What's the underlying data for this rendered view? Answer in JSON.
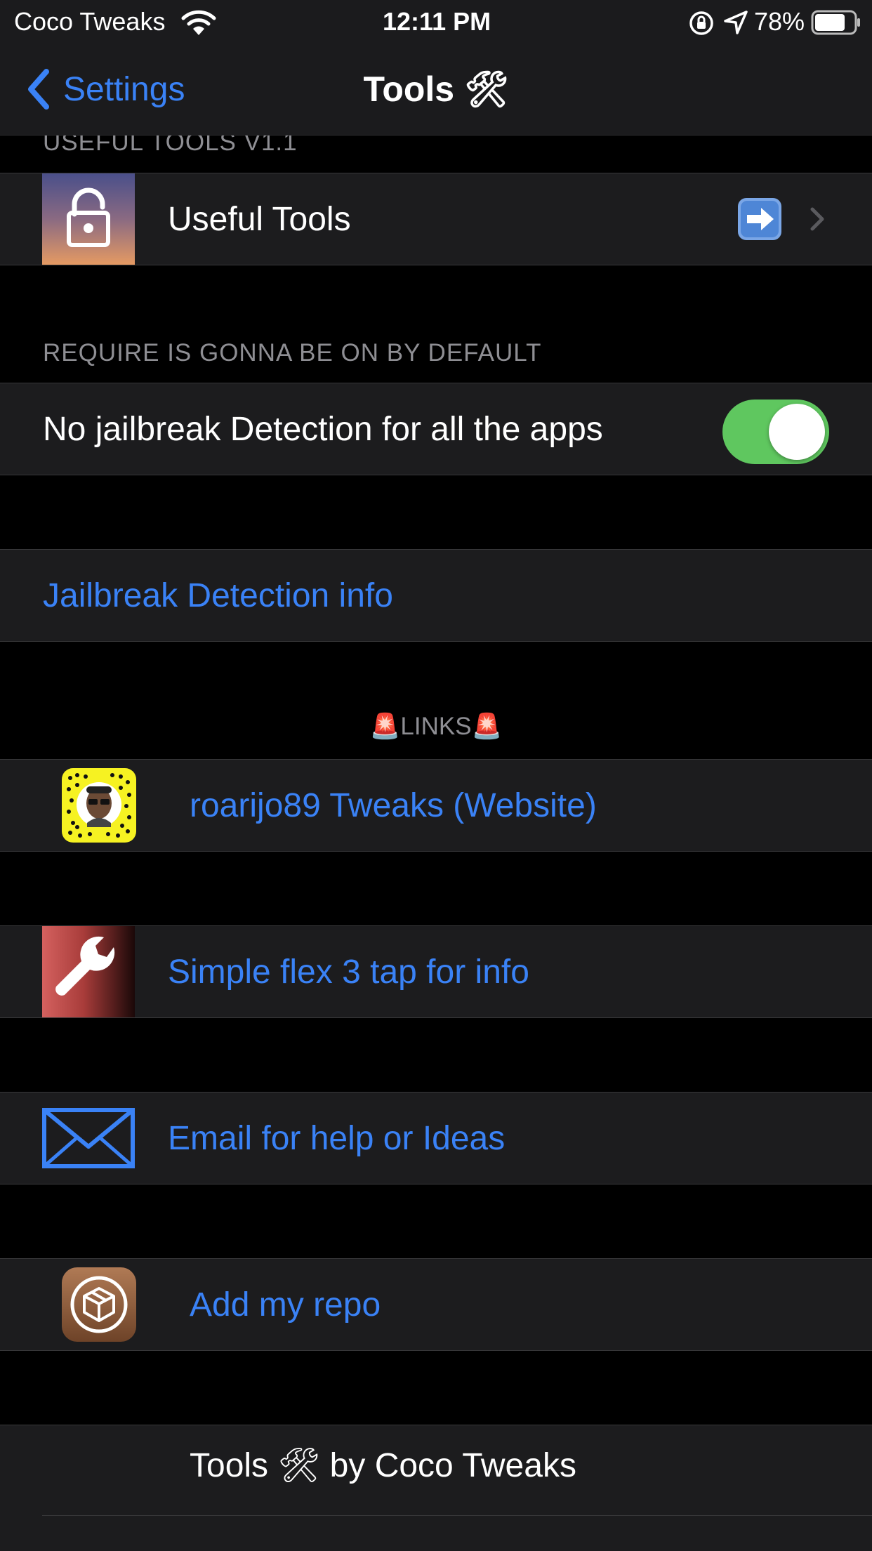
{
  "status_bar": {
    "carrier": "Coco Tweaks",
    "time": "12:11 PM",
    "battery_percent": "78%",
    "battery_level": 0.78
  },
  "nav": {
    "back_label": "Settings",
    "title": "Tools 🛠"
  },
  "sections": {
    "useful_tools_header": "USEFUL TOOLS V1.1",
    "useful_tools_label": "Useful Tools",
    "require_header": "REQUIRE IS GONNA BE ON BY DEFAULT",
    "no_jb_label": "No jailbreak Detection for all the apps",
    "no_jb_enabled": true,
    "jb_info_label": "Jailbreak Detection info",
    "links_header": "🚨LINKS🚨",
    "website_label": "roarijo89 Tweaks (Website)",
    "flex_label": "Simple flex 3 tap for info",
    "email_label": "Email for help or Ideas",
    "repo_label": "Add my repo",
    "footer_label": "Tools 🛠  by Coco Tweaks"
  },
  "colors": {
    "accent": "#3a82f6",
    "toggle_on": "#5fc75f",
    "cell_bg": "#1c1c1e"
  }
}
